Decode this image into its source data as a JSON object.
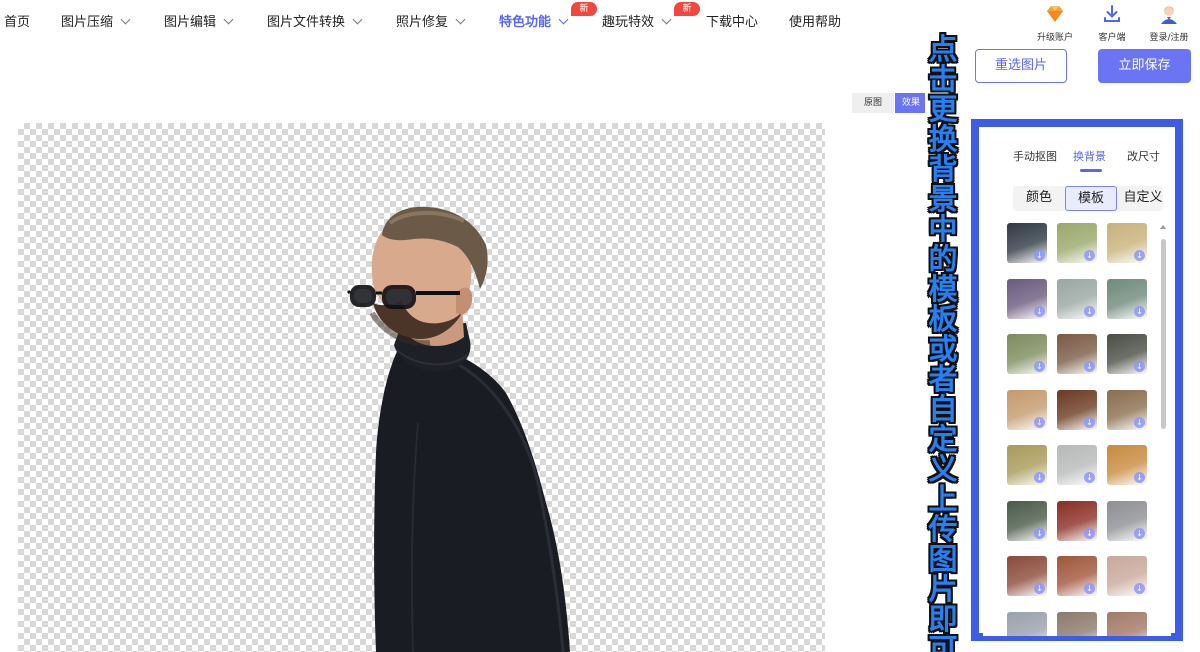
{
  "nav": {
    "items": [
      {
        "label": "首页",
        "dropdown": false
      },
      {
        "label": "图片压缩",
        "dropdown": true
      },
      {
        "label": "图片编辑",
        "dropdown": true
      },
      {
        "label": "图片文件转换",
        "dropdown": true
      },
      {
        "label": "照片修复",
        "dropdown": true
      },
      {
        "label": "特色功能",
        "dropdown": true,
        "active": true,
        "badge": "新"
      },
      {
        "label": "趣玩特效",
        "dropdown": true,
        "badge": "新"
      },
      {
        "label": "下载中心",
        "dropdown": false
      },
      {
        "label": "使用帮助",
        "dropdown": false
      }
    ]
  },
  "top_tools": [
    {
      "label": "升级账户",
      "icon": "diamond-icon"
    },
    {
      "label": "客户端",
      "icon": "download-icon"
    },
    {
      "label": "登录/注册",
      "icon": "user-avatar-icon"
    }
  ],
  "actions": {
    "reselect": "重选图片",
    "save": "立即保存"
  },
  "view_toggle": {
    "original": "原图",
    "effect": "效果"
  },
  "annotation": "点击更换背景中的模板或者自定义上传图片即可",
  "panel": {
    "tabs": [
      "手动抠图",
      "换背景",
      "改尺寸"
    ],
    "active_tab": "换背景",
    "subtabs": [
      "颜色",
      "模板",
      "自定义"
    ],
    "active_subtab": "模板",
    "templates": [
      {
        "name": "dark-landscape",
        "color": "#2f3a44"
      },
      {
        "name": "country-road",
        "color": "#9aa86a"
      },
      {
        "name": "desert-road",
        "color": "#c8b27a"
      },
      {
        "name": "purple-foliage",
        "color": "#6a5a7e"
      },
      {
        "name": "foggy-mountain",
        "color": "#9aa7a3"
      },
      {
        "name": "forest-road",
        "color": "#6f8a7c"
      },
      {
        "name": "river-trees",
        "color": "#7d8c5c"
      },
      {
        "name": "horse-closeup",
        "color": "#7a5a44"
      },
      {
        "name": "deer",
        "color": "#4a4e44"
      },
      {
        "name": "camel",
        "color": "#c49a6c"
      },
      {
        "name": "highland-cow",
        "color": "#6b3a22"
      },
      {
        "name": "horses-field",
        "color": "#8a6e4e"
      },
      {
        "name": "antelope",
        "color": "#a89a5a"
      },
      {
        "name": "snow-tiger",
        "color": "#b7b9b8"
      },
      {
        "name": "fox",
        "color": "#c88a3e"
      },
      {
        "name": "bull",
        "color": "#4a5a48"
      },
      {
        "name": "red-car",
        "color": "#8a2e24"
      },
      {
        "name": "suv",
        "color": "#8d8f93"
      },
      {
        "name": "classic-car",
        "color": "#8a4a3a"
      },
      {
        "name": "market-street",
        "color": "#a0553c"
      },
      {
        "name": "shop-street",
        "color": "#c9a89a"
      },
      {
        "name": "city-1",
        "color": "#9aa1ad"
      },
      {
        "name": "city-2",
        "color": "#8b7a6c"
      },
      {
        "name": "city-3",
        "color": "#a27a68"
      }
    ]
  }
}
